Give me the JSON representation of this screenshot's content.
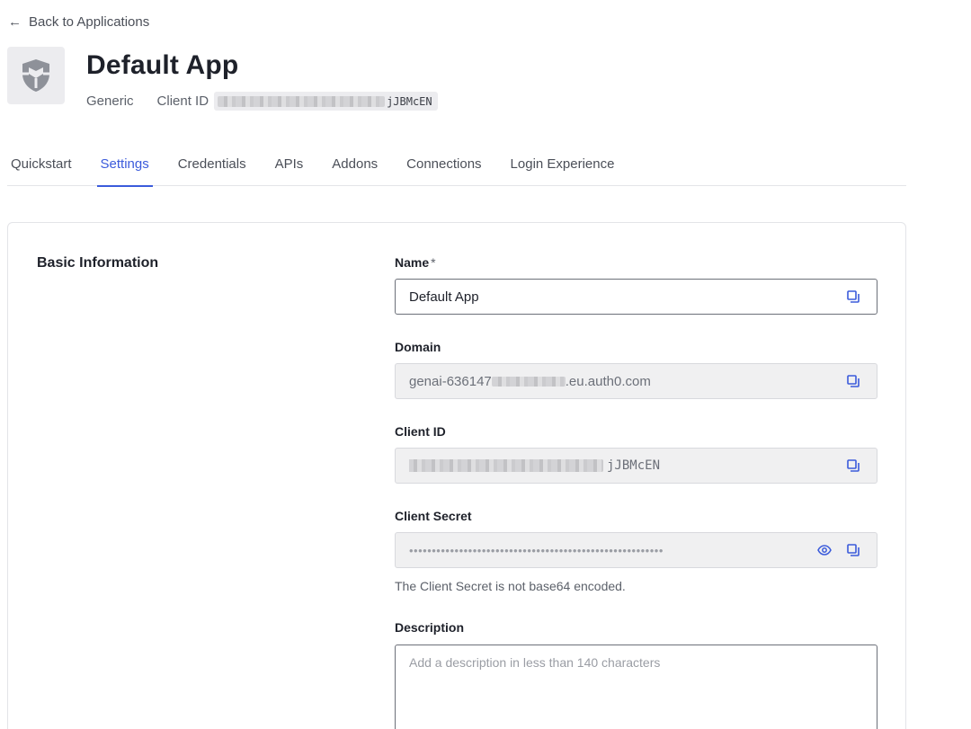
{
  "back_link": {
    "label": "Back to Applications"
  },
  "app": {
    "title": "Default App",
    "type": "Generic",
    "client_id_label": "Client ID",
    "client_id_visible_suffix": "jJBMcEN"
  },
  "tabs": [
    {
      "label": "Quickstart",
      "active": false
    },
    {
      "label": "Settings",
      "active": true
    },
    {
      "label": "Credentials",
      "active": false
    },
    {
      "label": "APIs",
      "active": false
    },
    {
      "label": "Addons",
      "active": false
    },
    {
      "label": "Connections",
      "active": false
    },
    {
      "label": "Login Experience",
      "active": false
    }
  ],
  "basic_info": {
    "section_title": "Basic Information",
    "name": {
      "label": "Name",
      "required_mark": "*",
      "value": "Default App"
    },
    "domain": {
      "label": "Domain",
      "value_prefix": "genai-636147",
      "value_suffix": ".eu.auth0.com"
    },
    "client_id": {
      "label": "Client ID",
      "value_suffix": "jJBMcEN"
    },
    "client_secret": {
      "label": "Client Secret",
      "masked_value": "••••••••••••••••••••••••••••••••••••••••••••••••••••••••",
      "helper": "The Client Secret is not base64 encoded."
    },
    "description": {
      "label": "Description",
      "placeholder": "Add a description in less than 140 characters"
    }
  },
  "colors": {
    "accent": "#3b5bdb",
    "text": "#1e212a",
    "muted": "#5c616a",
    "readonly_bg": "#f0f0f1"
  }
}
